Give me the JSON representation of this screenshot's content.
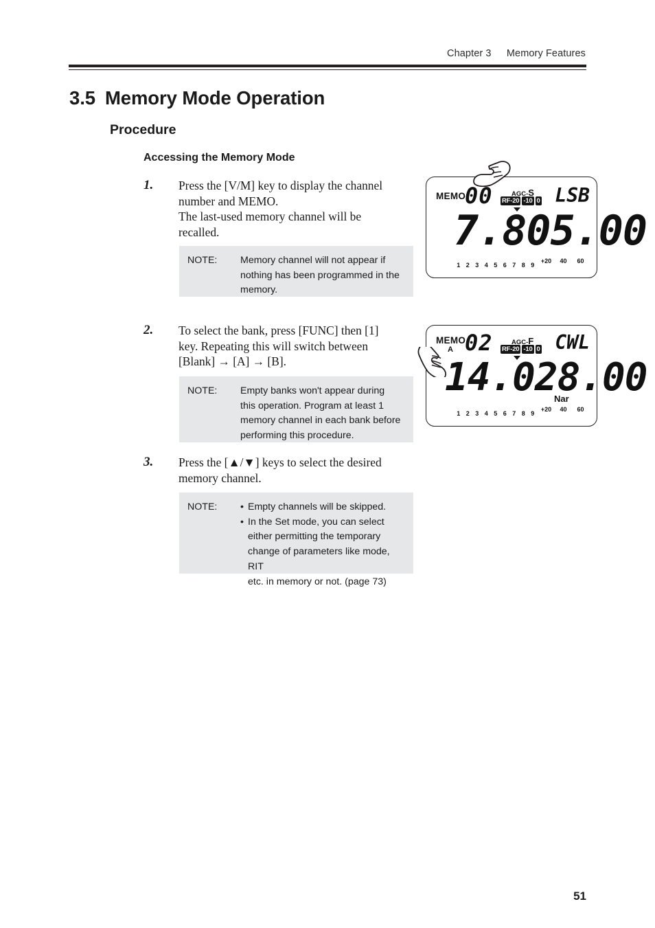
{
  "header": {
    "chapter": "Chapter 3",
    "chapter_title": "Memory Features"
  },
  "section": {
    "number": "3.5",
    "title": "Memory Mode Operation",
    "subsection": "Procedure",
    "subsubsection": "Accessing the Memory Mode"
  },
  "steps": [
    {
      "number": "1.",
      "lines": [
        "Press the [V/M] key to display the channel",
        "number and MEMO.",
        "The last-used memory channel will be",
        "recalled."
      ],
      "note": {
        "label": "NOTE:",
        "lines": [
          "Memory channel will not appear if",
          "nothing has been programmed in the",
          "memory."
        ]
      }
    },
    {
      "number": "2.",
      "lines": [
        "To select the bank, press [FUNC] then [1]",
        "key. Repeating this will switch between",
        "[Blank] → [A] → [B]."
      ],
      "note": {
        "label": "NOTE:",
        "lines": [
          "Empty banks won't appear during",
          "this operation. Program at least 1",
          "memory channel in each bank before",
          "performing this procedure."
        ]
      }
    },
    {
      "number": "3.",
      "lines": [
        "Press the [▲/▼] keys to select the desired",
        "memory channel."
      ],
      "note": {
        "label": "NOTE:",
        "bullets": [
          {
            "bullet": "•",
            "lines": [
              "Empty channels will be skipped."
            ]
          },
          {
            "bullet": "•",
            "lines": [
              "In the Set mode, you can select",
              "either permitting the temporary",
              "change of parameters like mode, RIT",
              "etc. in memory or not. (page 73)"
            ]
          }
        ]
      }
    }
  ],
  "lcd_displays": [
    {
      "memo_label": "MEMO",
      "bank": "",
      "channel": "00",
      "agc_prefix": "AGC-",
      "agc_value": "S",
      "rf_chips": [
        "RF-20",
        "-10",
        "0"
      ],
      "mode": "LSB",
      "frequency": "7.805.00",
      "narrow": "",
      "scale_numbers": [
        "1",
        "2",
        "3",
        "4",
        "5",
        "6",
        "7",
        "8",
        "9"
      ],
      "scale_plus": [
        "+20",
        "40",
        "60"
      ]
    },
    {
      "memo_label": "MEMO",
      "bank": "A",
      "channel": "02",
      "agc_prefix": "AGC-",
      "agc_value": "F",
      "rf_chips": [
        "RF-20",
        "-10",
        "0"
      ],
      "mode": "CWL",
      "frequency": "14.028.00",
      "narrow": "Nar",
      "scale_numbers": [
        "1",
        "2",
        "3",
        "4",
        "5",
        "6",
        "7",
        "8",
        "9"
      ],
      "scale_plus": [
        "+20",
        "40",
        "60"
      ]
    }
  ],
  "page_number": "51",
  "colors": {
    "rule": "#231f20",
    "note_bg": "#e6e7e8",
    "text": "#1a1a1a"
  }
}
